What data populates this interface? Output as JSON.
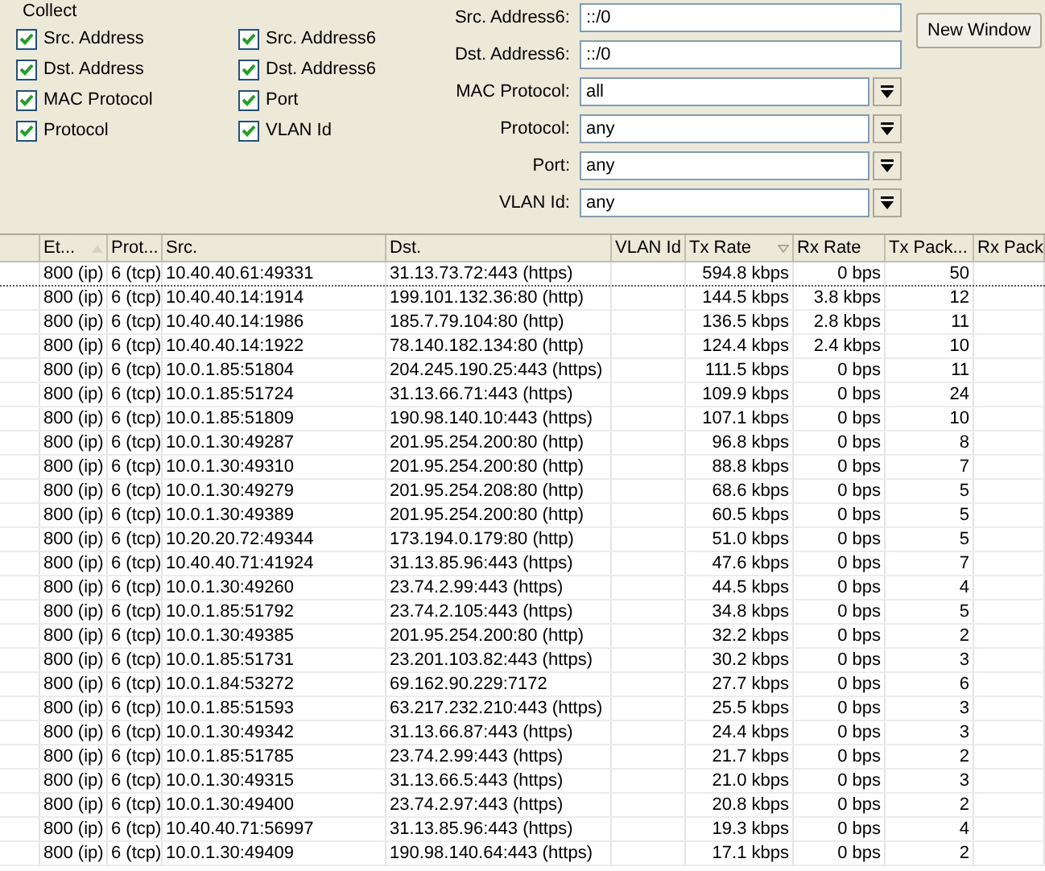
{
  "collect": {
    "title": "Collect",
    "options": [
      {
        "label": "Src. Address",
        "checked": true
      },
      {
        "label": "Src. Address6",
        "checked": true
      },
      {
        "label": "Dst. Address",
        "checked": true
      },
      {
        "label": "Dst. Address6",
        "checked": true
      },
      {
        "label": "MAC Protocol",
        "checked": true
      },
      {
        "label": "Port",
        "checked": true
      },
      {
        "label": "Protocol",
        "checked": true
      },
      {
        "label": "VLAN Id",
        "checked": true
      }
    ]
  },
  "filters": [
    {
      "kind": "text",
      "label": "Src. Address6:",
      "value": "::/0"
    },
    {
      "kind": "text",
      "label": "Dst. Address6:",
      "value": "::/0"
    },
    {
      "kind": "dropdown",
      "label": "MAC Protocol:",
      "value": "all"
    },
    {
      "kind": "dropdown",
      "label": "Protocol:",
      "value": "any"
    },
    {
      "kind": "dropdown",
      "label": "Port:",
      "value": "any"
    },
    {
      "kind": "dropdown",
      "label": "VLAN Id:",
      "value": "any"
    }
  ],
  "new_window_button": "New Window",
  "table": {
    "columns": [
      {
        "label": "Et...",
        "sorted": true,
        "descending": false
      },
      {
        "label": "Prot...",
        "sorted": false
      },
      {
        "label": "Src.",
        "sorted": false
      },
      {
        "label": "Dst.",
        "sorted": false
      },
      {
        "label": "VLAN Id",
        "sorted": false
      },
      {
        "label": "Tx Rate",
        "sorted": true,
        "descending": true
      },
      {
        "label": "Rx Rate",
        "sorted": false
      },
      {
        "label": "Tx Pack...",
        "sorted": false
      },
      {
        "label": "Rx Pack",
        "sorted": false
      }
    ],
    "rows": [
      {
        "selected": true,
        "cells": [
          "800 (ip)",
          "6 (tcp)",
          "10.40.40.61:49331",
          "31.13.73.72:443 (https)",
          "",
          "594.8 kbps",
          "0 bps",
          "50",
          ""
        ]
      },
      {
        "selected": false,
        "cells": [
          "800 (ip)",
          "6 (tcp)",
          "10.40.40.14:1914",
          "199.101.132.36:80 (http)",
          "",
          "144.5 kbps",
          "3.8 kbps",
          "12",
          ""
        ]
      },
      {
        "selected": false,
        "cells": [
          "800 (ip)",
          "6 (tcp)",
          "10.40.40.14:1986",
          "185.7.79.104:80 (http)",
          "",
          "136.5 kbps",
          "2.8 kbps",
          "11",
          ""
        ]
      },
      {
        "selected": false,
        "cells": [
          "800 (ip)",
          "6 (tcp)",
          "10.40.40.14:1922",
          "78.140.182.134:80 (http)",
          "",
          "124.4 kbps",
          "2.4 kbps",
          "10",
          ""
        ]
      },
      {
        "selected": false,
        "cells": [
          "800 (ip)",
          "6 (tcp)",
          "10.0.1.85:51804",
          "204.245.190.25:443 (https)",
          "",
          "111.5 kbps",
          "0 bps",
          "11",
          ""
        ]
      },
      {
        "selected": false,
        "cells": [
          "800 (ip)",
          "6 (tcp)",
          "10.0.1.85:51724",
          "31.13.66.71:443 (https)",
          "",
          "109.9 kbps",
          "0 bps",
          "24",
          ""
        ]
      },
      {
        "selected": false,
        "cells": [
          "800 (ip)",
          "6 (tcp)",
          "10.0.1.85:51809",
          "190.98.140.10:443 (https)",
          "",
          "107.1 kbps",
          "0 bps",
          "10",
          ""
        ]
      },
      {
        "selected": false,
        "cells": [
          "800 (ip)",
          "6 (tcp)",
          "10.0.1.30:49287",
          "201.95.254.200:80 (http)",
          "",
          "96.8 kbps",
          "0 bps",
          "8",
          ""
        ]
      },
      {
        "selected": false,
        "cells": [
          "800 (ip)",
          "6 (tcp)",
          "10.0.1.30:49310",
          "201.95.254.200:80 (http)",
          "",
          "88.8 kbps",
          "0 bps",
          "7",
          ""
        ]
      },
      {
        "selected": false,
        "cells": [
          "800 (ip)",
          "6 (tcp)",
          "10.0.1.30:49279",
          "201.95.254.208:80 (http)",
          "",
          "68.6 kbps",
          "0 bps",
          "5",
          ""
        ]
      },
      {
        "selected": false,
        "cells": [
          "800 (ip)",
          "6 (tcp)",
          "10.0.1.30:49389",
          "201.95.254.200:80 (http)",
          "",
          "60.5 kbps",
          "0 bps",
          "5",
          ""
        ]
      },
      {
        "selected": false,
        "cells": [
          "800 (ip)",
          "6 (tcp)",
          "10.20.20.72:49344",
          "173.194.0.179:80 (http)",
          "",
          "51.0 kbps",
          "0 bps",
          "5",
          ""
        ]
      },
      {
        "selected": false,
        "cells": [
          "800 (ip)",
          "6 (tcp)",
          "10.40.40.71:41924",
          "31.13.85.96:443 (https)",
          "",
          "47.6 kbps",
          "0 bps",
          "7",
          ""
        ]
      },
      {
        "selected": false,
        "cells": [
          "800 (ip)",
          "6 (tcp)",
          "10.0.1.30:49260",
          "23.74.2.99:443 (https)",
          "",
          "44.5 kbps",
          "0 bps",
          "4",
          ""
        ]
      },
      {
        "selected": false,
        "cells": [
          "800 (ip)",
          "6 (tcp)",
          "10.0.1.85:51792",
          "23.74.2.105:443 (https)",
          "",
          "34.8 kbps",
          "0 bps",
          "5",
          ""
        ]
      },
      {
        "selected": false,
        "cells": [
          "800 (ip)",
          "6 (tcp)",
          "10.0.1.30:49385",
          "201.95.254.200:80 (http)",
          "",
          "32.2 kbps",
          "0 bps",
          "2",
          ""
        ]
      },
      {
        "selected": false,
        "cells": [
          "800 (ip)",
          "6 (tcp)",
          "10.0.1.85:51731",
          "23.201.103.82:443 (https)",
          "",
          "30.2 kbps",
          "0 bps",
          "3",
          ""
        ]
      },
      {
        "selected": false,
        "cells": [
          "800 (ip)",
          "6 (tcp)",
          "10.0.1.84:53272",
          "69.162.90.229:7172",
          "",
          "27.7 kbps",
          "0 bps",
          "6",
          ""
        ]
      },
      {
        "selected": false,
        "cells": [
          "800 (ip)",
          "6 (tcp)",
          "10.0.1.85:51593",
          "63.217.232.210:443 (https)",
          "",
          "25.5 kbps",
          "0 bps",
          "3",
          ""
        ]
      },
      {
        "selected": false,
        "cells": [
          "800 (ip)",
          "6 (tcp)",
          "10.0.1.30:49342",
          "31.13.66.87:443 (https)",
          "",
          "24.4 kbps",
          "0 bps",
          "3",
          ""
        ]
      },
      {
        "selected": false,
        "cells": [
          "800 (ip)",
          "6 (tcp)",
          "10.0.1.85:51785",
          "23.74.2.99:443 (https)",
          "",
          "21.7 kbps",
          "0 bps",
          "2",
          ""
        ]
      },
      {
        "selected": false,
        "cells": [
          "800 (ip)",
          "6 (tcp)",
          "10.0.1.30:49315",
          "31.13.66.5:443 (https)",
          "",
          "21.0 kbps",
          "0 bps",
          "3",
          ""
        ]
      },
      {
        "selected": false,
        "cells": [
          "800 (ip)",
          "6 (tcp)",
          "10.0.1.30:49400",
          "23.74.2.97:443 (https)",
          "",
          "20.8 kbps",
          "0 bps",
          "2",
          ""
        ]
      },
      {
        "selected": false,
        "cells": [
          "800 (ip)",
          "6 (tcp)",
          "10.40.40.71:56997",
          "31.13.85.96:443 (https)",
          "",
          "19.3 kbps",
          "0 bps",
          "4",
          ""
        ]
      },
      {
        "selected": false,
        "cells": [
          "800 (ip)",
          "6 (tcp)",
          "10.0.1.30:49409",
          "190.98.140.64:443 (https)",
          "",
          "17.1 kbps",
          "0 bps",
          "2",
          ""
        ]
      }
    ]
  }
}
